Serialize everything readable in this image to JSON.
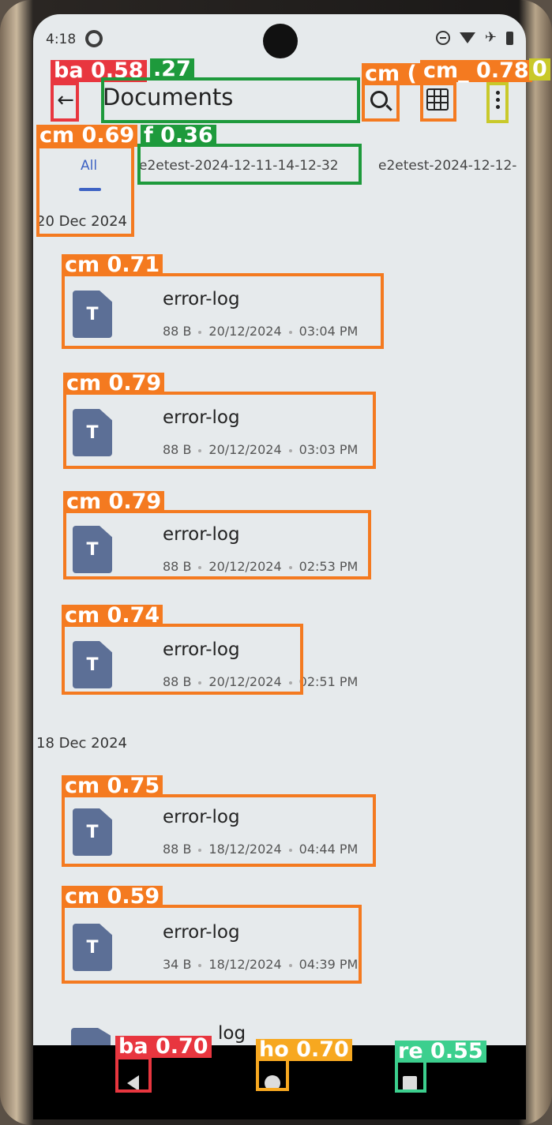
{
  "status_bar": {
    "time": "4:18"
  },
  "app_bar": {
    "title": "Documents"
  },
  "tabs": [
    {
      "label": "All",
      "selected": true
    },
    {
      "label": "e2etest-2024-12-11-14-12-32"
    },
    {
      "label": "e2etest-2024-12-12-"
    }
  ],
  "sections": [
    {
      "date": "20 Dec 2024",
      "files": [
        {
          "name": "error-log",
          "size": "88 B",
          "date": "20/12/2024",
          "time": "03:04 PM"
        },
        {
          "name": "error-log",
          "size": "88 B",
          "date": "20/12/2024",
          "time": "03:03 PM"
        },
        {
          "name": "error-log",
          "size": "88 B",
          "date": "20/12/2024",
          "time": "02:53 PM"
        },
        {
          "name": "error-log",
          "size": "88 B",
          "date": "20/12/2024",
          "time": "02:51 PM"
        }
      ]
    },
    {
      "date": "18 Dec 2024",
      "files": [
        {
          "name": "error-log",
          "size": "88 B",
          "date": "18/12/2024",
          "time": "04:44 PM"
        },
        {
          "name": "error-log",
          "size": "34 B",
          "date": "18/12/2024",
          "time": "04:39 PM"
        }
      ]
    }
  ],
  "partial_item": {
    "name": "log"
  },
  "file_icon_letter": "T",
  "colors": {
    "accent": "#3e63c4",
    "file_icon": "#5c6f96",
    "background": "#e6eaec"
  },
  "detections": [
    {
      "label": "ba 0.58",
      "color": "#e8363f"
    },
    {
      "label": ".27",
      "color": "#1e9a3c"
    },
    {
      "label": "cm (",
      "color": "#f47a20"
    },
    {
      "label": "cm_ 0.78",
      "color": "#f47a20"
    },
    {
      "label": "0",
      "color": "#c9c92a"
    },
    {
      "label": "cm 0.69",
      "color": "#f47a20"
    },
    {
      "label": "f 0.36",
      "color": "#1e9a3c"
    },
    {
      "label": "cm 0.71",
      "color": "#f47a20"
    },
    {
      "label": "cm 0.79",
      "color": "#f47a20"
    },
    {
      "label": "cm 0.79",
      "color": "#f47a20"
    },
    {
      "label": "cm 0.74",
      "color": "#f47a20"
    },
    {
      "label": "cm 0.75",
      "color": "#f47a20"
    },
    {
      "label": "cm 0.59",
      "color": "#f47a20"
    },
    {
      "label": "ba 0.70",
      "color": "#e8363f"
    },
    {
      "label": "ho 0.70",
      "color": "#f7a820"
    },
    {
      "label": "re 0.55",
      "color": "#3ccf8e"
    }
  ]
}
